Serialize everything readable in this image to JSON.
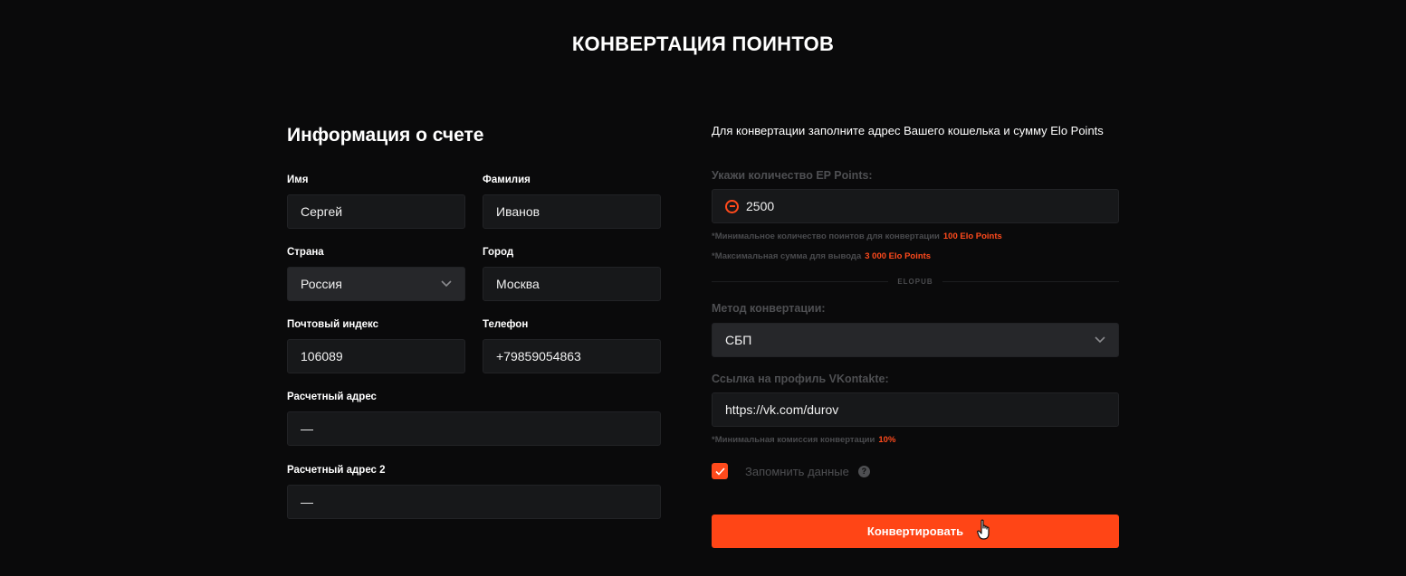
{
  "page": {
    "title": "КОНВЕРТАЦИЯ ПОИНТОВ"
  },
  "account": {
    "title": "Информация о счете",
    "first_name": {
      "label": "Имя",
      "value": "Сергей"
    },
    "last_name": {
      "label": "Фамилия",
      "value": "Иванов"
    },
    "country": {
      "label": "Страна",
      "value": "Россия"
    },
    "city": {
      "label": "Город",
      "value": "Москва"
    },
    "postal": {
      "label": "Почтовый индекс",
      "value": "106089"
    },
    "phone": {
      "label": "Телефон",
      "value": "+79859054863"
    },
    "address1": {
      "label": "Расчетный адрес",
      "value": "—"
    },
    "address2": {
      "label": "Расчетный адрес 2",
      "value": "—"
    }
  },
  "convert": {
    "intro": "Для конвертации заполните адрес Вашего кошелька и сумму Elo Points",
    "amount_label": "Укажи количество EP Points:",
    "amount_value": "2500",
    "min_note": "*Минимальное количество поинтов для конвертации",
    "min_value": "100 Elo Points",
    "max_note": "*Максимальная сумма для вывода",
    "max_value": "3 000 Elo Points",
    "divider_text": "ELOPUB",
    "method_label": "Метод конвертации:",
    "method_value": "СБП",
    "profile_label": "Ссылка на профиль VKontakte:",
    "profile_value": "https://vk.com/durov",
    "fee_note": "*Минимальная комиссия конвертации",
    "fee_value": "10%",
    "remember_label": "Запомнить данные",
    "remember_checked": true,
    "help_glyph": "?",
    "submit_label": "Конвертировать"
  },
  "icons": {
    "select": "chevron-down-icon",
    "coin": "elo-coin-icon",
    "check": "checkmark-icon",
    "help": "question-icon",
    "cursor": "hand-pointer-icon"
  },
  "colors": {
    "accent": "#ff4516",
    "background": "#0a0a0b",
    "input": "#17181a"
  }
}
